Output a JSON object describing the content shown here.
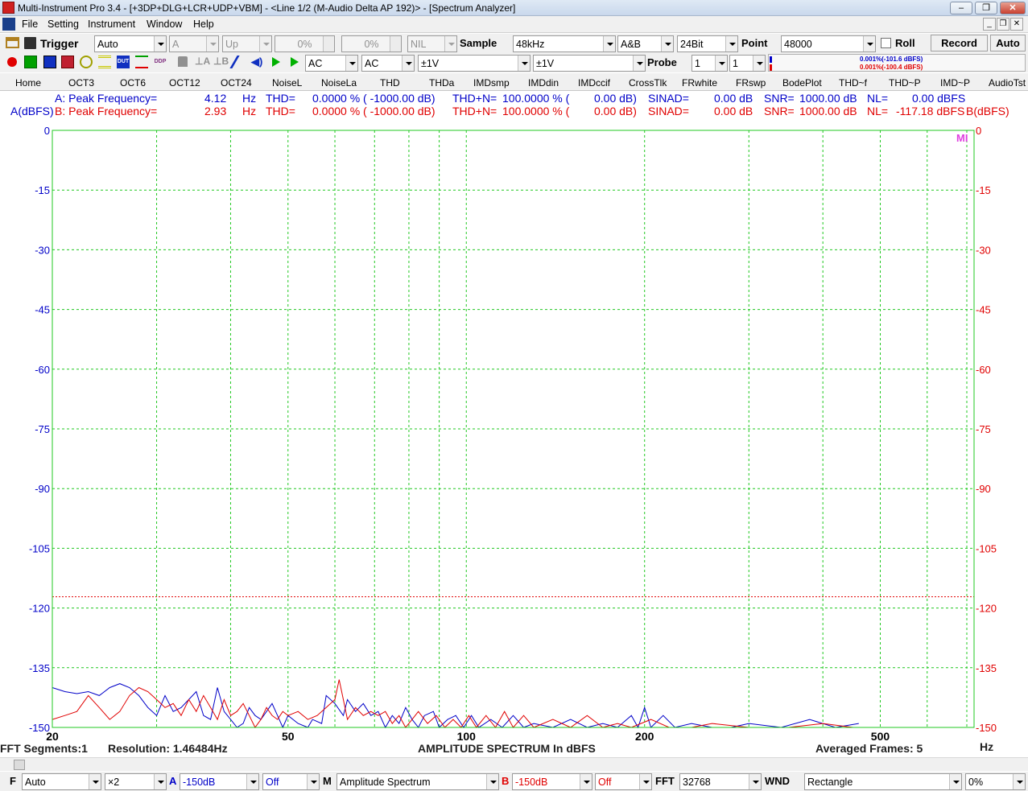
{
  "window": {
    "title": "Multi-Instrument Pro 3.4   -   [+3DP+DLG+LCR+UDP+VBM]   -   <Line 1/2 (M-Audio Delta AP 192)> - [Spectrum Analyzer]"
  },
  "menu": [
    "File",
    "Setting",
    "Instrument",
    "Window",
    "Help"
  ],
  "toolbar1": {
    "trigger_label": "Trigger",
    "trigger_mode": "Auto",
    "trigger_channel": "A",
    "trigger_edge": "Up",
    "trigger_level": "0%",
    "trigger_delay": "0%",
    "nil": "NIL",
    "sample_label": "Sample",
    "sample_rate": "48kHz",
    "channels": "A&B",
    "bits": "24Bit",
    "point_label": "Point",
    "points": "48000",
    "roll_label": "Roll",
    "record_label": "Record",
    "auto_label": "Auto"
  },
  "toolbar2": {
    "coupling_a": "AC",
    "coupling_b": "AC",
    "range_a": "±1V",
    "range_b": "±1V",
    "probe_label": "Probe",
    "probe_a": "1",
    "probe_b": "1",
    "level_a": "0.001%(-101.6 dBFS)",
    "level_b": "0.001%(-100.4 dBFS)",
    "icons": [
      "record-icon",
      "oscilloscope-icon",
      "spectrum-icon",
      "spectrum3d-icon",
      "phase-icon",
      "waterfall-icon",
      "dut-icon",
      "multimeter-icon",
      "ddp-icon",
      "weight-icon",
      "weight-a-icon",
      "weight-b-icon",
      "probe-icon",
      "speaker-icon",
      "play-icon",
      "play-step-icon"
    ]
  },
  "tabs": [
    "Home",
    "OCT3",
    "OCT6",
    "OCT12",
    "OCT24",
    "NoiseL",
    "NoiseLa",
    "THD",
    "THDa",
    "IMDsmp",
    "IMDdin",
    "IMDccif",
    "CrossTlk",
    "FRwhite",
    "FRswp",
    "BodePlot",
    "THD~f",
    "THD~P",
    "IMD~P",
    "AudioTst"
  ],
  "readouts": {
    "a": {
      "label": "A: Peak Frequency=",
      "freq": "4.12",
      "freq_unit": "Hz",
      "thd_label": "THD=",
      "thd": "0.0000 % (  -1000.00 dB)",
      "thdn_label": "THD+N=",
      "thdn": "100.0000 % (",
      "thdn_db": "0.00 dB)",
      "sinad_label": "SINAD=",
      "sinad": "0.00 dB",
      "snr_label": "SNR=",
      "snr": "1000.00 dB",
      "nl_label": "NL=",
      "nl": "0.00 dBFS"
    },
    "b": {
      "label": "B: Peak Frequency=",
      "freq": "2.93",
      "freq_unit": "Hz",
      "thd_label": "THD=",
      "thd": "0.0000 % (  -1000.00 dB)",
      "thdn_label": "THD+N=",
      "thdn": "100.0000 % (",
      "thdn_db": "0.00 dB)",
      "sinad_label": "SINAD=",
      "sinad": "0.00 dB",
      "snr_label": "SNR=",
      "snr": "1000.00 dB",
      "nl_label": "NL=",
      "nl": "-117.18 dBFS"
    },
    "a_unit": "A(dBFS)",
    "b_unit": "B(dBFS)"
  },
  "chart_data": {
    "type": "line",
    "title": "AMPLITUDE SPECTRUM In dBFS",
    "xlabel": "Hz",
    "ylabel_left": "A(dBFS)",
    "ylabel_right": "B(dBFS)",
    "xscale": "log",
    "xlim": [
      20,
      720
    ],
    "ylim": [
      -150,
      0
    ],
    "yticks": [
      0,
      -15,
      -30,
      -45,
      -60,
      -75,
      -90,
      -105,
      -120,
      -135,
      -150
    ],
    "xtick_labels": [
      {
        "value": 20,
        "label": "20"
      },
      {
        "value": 50,
        "label": "50"
      },
      {
        "value": 100,
        "label": "100"
      },
      {
        "value": 200,
        "label": "200"
      },
      {
        "value": 500,
        "label": "500"
      }
    ],
    "grid": true,
    "reference_line": {
      "value": -117.18,
      "color": "#e00000",
      "style": "dashed"
    },
    "logo": "MI",
    "series": [
      {
        "color": "#0000c8",
        "points": [
          [
            20,
            -140
          ],
          [
            21,
            -141
          ],
          [
            22,
            -141.5
          ],
          [
            23,
            -141
          ],
          [
            24,
            -142
          ],
          [
            25,
            -140
          ],
          [
            26,
            -139
          ],
          [
            27,
            -140
          ],
          [
            28,
            -142
          ],
          [
            29,
            -145
          ],
          [
            30,
            -147
          ],
          [
            31,
            -142
          ],
          [
            32,
            -146
          ],
          [
            33,
            -145
          ],
          [
            34,
            -143
          ],
          [
            35,
            -141
          ],
          [
            36,
            -147
          ],
          [
            37,
            -148
          ],
          [
            38,
            -140
          ],
          [
            39,
            -146
          ],
          [
            40,
            -148
          ],
          [
            41,
            -150
          ],
          [
            42,
            -149
          ],
          [
            43,
            -145
          ],
          [
            44,
            -147
          ],
          [
            45,
            -148
          ],
          [
            46,
            -146
          ],
          [
            47,
            -144
          ],
          [
            48,
            -147
          ],
          [
            49,
            -150
          ],
          [
            50,
            -147
          ],
          [
            52,
            -149
          ],
          [
            54,
            -150
          ],
          [
            55,
            -148
          ],
          [
            57,
            -149
          ],
          [
            58,
            -142
          ],
          [
            60,
            -144
          ],
          [
            62,
            -147
          ],
          [
            63,
            -143
          ],
          [
            65,
            -146
          ],
          [
            67,
            -144
          ],
          [
            69,
            -147
          ],
          [
            71,
            -146
          ],
          [
            73,
            -150
          ],
          [
            75,
            -147
          ],
          [
            77,
            -149
          ],
          [
            79,
            -145
          ],
          [
            81,
            -148
          ],
          [
            83,
            -150
          ],
          [
            85,
            -147
          ],
          [
            88,
            -146
          ],
          [
            90,
            -150
          ],
          [
            93,
            -148
          ],
          [
            96,
            -147
          ],
          [
            99,
            -150
          ],
          [
            102,
            -147
          ],
          [
            105,
            -150
          ],
          [
            110,
            -148
          ],
          [
            115,
            -150
          ],
          [
            120,
            -147
          ],
          [
            125,
            -150
          ],
          [
            130,
            -149
          ],
          [
            140,
            -150
          ],
          [
            150,
            -148
          ],
          [
            160,
            -150
          ],
          [
            170,
            -149
          ],
          [
            180,
            -150
          ],
          [
            190,
            -147
          ],
          [
            195,
            -150
          ],
          [
            200,
            -145
          ],
          [
            205,
            -150
          ],
          [
            215,
            -147
          ],
          [
            225,
            -150
          ],
          [
            240,
            -149
          ],
          [
            260,
            -150
          ],
          [
            280,
            -150
          ],
          [
            300,
            -149
          ],
          [
            340,
            -150
          ],
          [
            380,
            -148
          ],
          [
            420,
            -150
          ],
          [
            460,
            -149
          ]
        ]
      },
      {
        "color": "#e00000",
        "points": [
          [
            20,
            -148
          ],
          [
            21,
            -147
          ],
          [
            22,
            -146
          ],
          [
            23,
            -142
          ],
          [
            24,
            -145
          ],
          [
            25,
            -148
          ],
          [
            26,
            -146
          ],
          [
            27,
            -142
          ],
          [
            28,
            -140
          ],
          [
            29,
            -141
          ],
          [
            30,
            -143
          ],
          [
            31,
            -145
          ],
          [
            32,
            -144
          ],
          [
            33,
            -147
          ],
          [
            34,
            -143
          ],
          [
            35,
            -146
          ],
          [
            36,
            -142
          ],
          [
            37,
            -145
          ],
          [
            38,
            -148
          ],
          [
            39,
            -143
          ],
          [
            40,
            -147
          ],
          [
            41,
            -146
          ],
          [
            42,
            -144
          ],
          [
            43,
            -147
          ],
          [
            44,
            -150
          ],
          [
            45,
            -148
          ],
          [
            46,
            -145
          ],
          [
            47,
            -147
          ],
          [
            48,
            -148
          ],
          [
            49,
            -146
          ],
          [
            50,
            -147
          ],
          [
            52,
            -146
          ],
          [
            54,
            -148
          ],
          [
            56,
            -147
          ],
          [
            58,
            -145
          ],
          [
            60,
            -143
          ],
          [
            61,
            -138
          ],
          [
            62,
            -143
          ],
          [
            63,
            -148
          ],
          [
            65,
            -145
          ],
          [
            67,
            -147
          ],
          [
            69,
            -146
          ],
          [
            71,
            -147
          ],
          [
            73,
            -146
          ],
          [
            75,
            -149
          ],
          [
            77,
            -147
          ],
          [
            79,
            -150
          ],
          [
            81,
            -148
          ],
          [
            83,
            -146
          ],
          [
            86,
            -149
          ],
          [
            89,
            -147
          ],
          [
            92,
            -150
          ],
          [
            95,
            -148
          ],
          [
            98,
            -150
          ],
          [
            101,
            -147
          ],
          [
            104,
            -150
          ],
          [
            108,
            -147
          ],
          [
            112,
            -150
          ],
          [
            116,
            -146
          ],
          [
            120,
            -150
          ],
          [
            125,
            -147
          ],
          [
            130,
            -150
          ],
          [
            140,
            -148
          ],
          [
            150,
            -150
          ],
          [
            160,
            -147
          ],
          [
            170,
            -150
          ],
          [
            180,
            -149
          ],
          [
            190,
            -150
          ],
          [
            205,
            -148
          ],
          [
            220,
            -150
          ],
          [
            240,
            -150
          ],
          [
            260,
            -149
          ],
          [
            300,
            -150
          ],
          [
            350,
            -150
          ],
          [
            400,
            -149
          ],
          [
            450,
            -150
          ]
        ]
      }
    ]
  },
  "status": {
    "fft_segments": "FFT Segments:1",
    "resolution": "Resolution: 1.46484Hz",
    "chart_title": "AMPLITUDE SPECTRUM In dBFS",
    "averaged": "Averaged Frames: 5",
    "x_unit": "Hz"
  },
  "bottombar": {
    "f_label": "F",
    "f_mode": "Auto",
    "zoom": "×2",
    "a_label": "A",
    "a_floor": "-150dB",
    "a_offset": "Off",
    "m_label": "M",
    "mode": "Amplitude Spectrum",
    "b_label": "B",
    "b_floor": "-150dB",
    "b_offset": "Off",
    "fft_label": "FFT",
    "fft_size": "32768",
    "wnd_label": "WND",
    "window": "Rectangle",
    "overlap": "0%"
  }
}
